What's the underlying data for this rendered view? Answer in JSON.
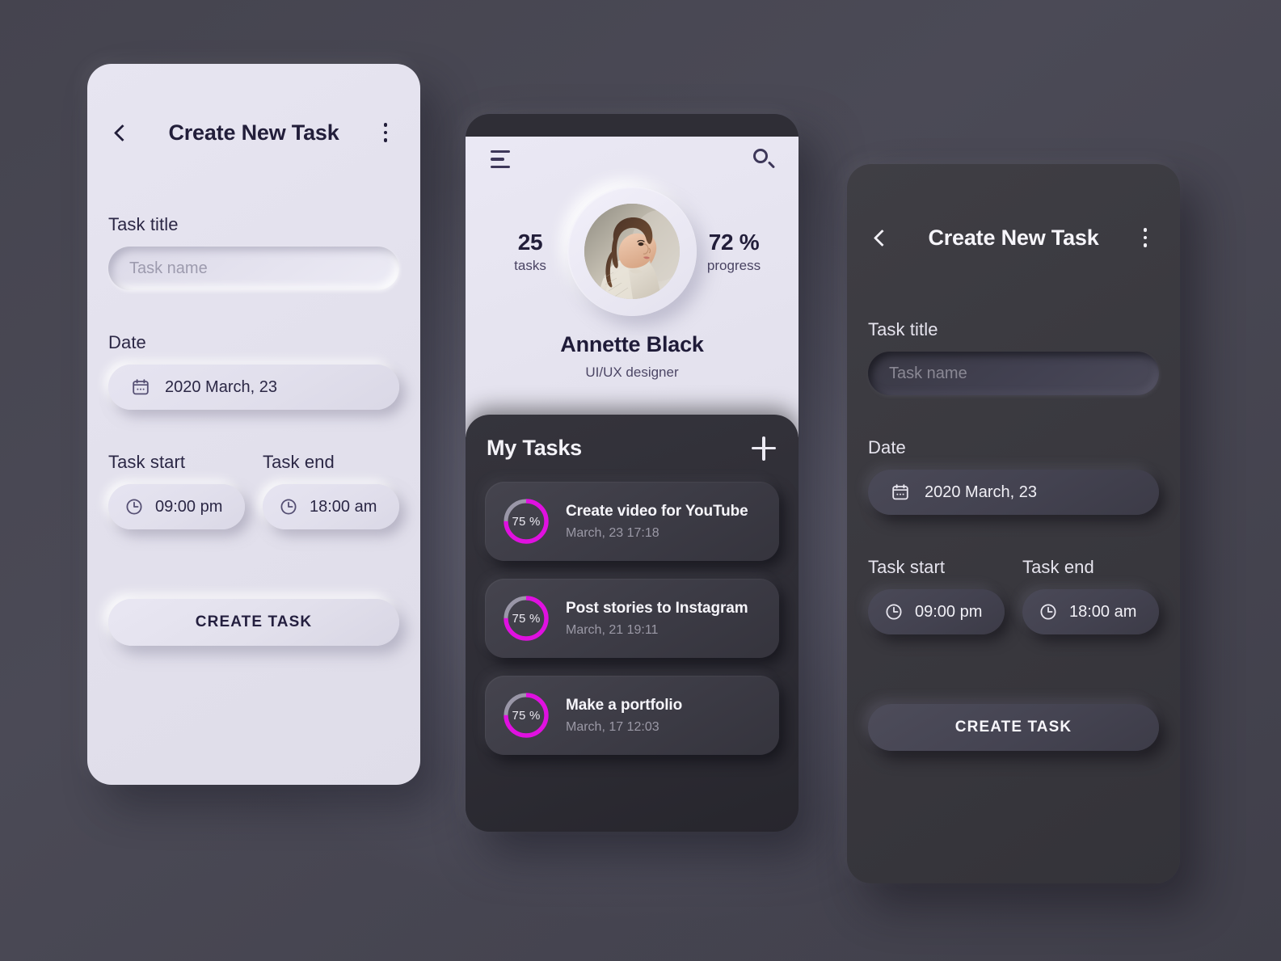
{
  "theme": {
    "accent_magenta": "#e010e0",
    "light_surface": "#e3e1ed",
    "dark_surface": "#3a393f",
    "page_background": "#44434e",
    "ring_track": "#9a97a8"
  },
  "screen_light": {
    "appbar": {
      "back_icon": "chevron-left-icon",
      "title": "Create New Task",
      "menu_icon": "kebab-menu-icon"
    },
    "labels": {
      "task_title": "Task title",
      "date": "Date",
      "task_start": "Task start",
      "task_end": "Task end"
    },
    "task_name_input": {
      "value": "",
      "placeholder": "Task name"
    },
    "date_value": "2020 March, 23",
    "date_icon": "calendar-icon",
    "start_value": "09:00 pm",
    "start_icon": "clock-icon",
    "end_value": "18:00 am",
    "end_icon": "clock-icon",
    "submit_label": "CREATE TASK"
  },
  "screen_profile": {
    "appbar": {
      "menu_icon": "hamburger-menu-icon",
      "search_icon": "search-icon"
    },
    "stats": {
      "tasks_count": "25",
      "tasks_label": "tasks",
      "progress_value": "72 %",
      "progress_label": "progress"
    },
    "avatar_alt": "avatar",
    "name": "Annette Black",
    "role": "UI/UX designer",
    "tasks_section": {
      "title": "My Tasks",
      "add_icon": "plus-icon",
      "items": [
        {
          "percent": "75 %",
          "percent_value": 75,
          "name": "Create video for YouTube",
          "date": "March, 23 17:18"
        },
        {
          "percent": "75 %",
          "percent_value": 75,
          "name": "Post stories to Instagram",
          "date": "March, 21 19:11"
        },
        {
          "percent": "75 %",
          "percent_value": 75,
          "name": "Make a portfolio",
          "date": "March, 17 12:03"
        }
      ]
    }
  },
  "screen_dark": {
    "appbar": {
      "back_icon": "chevron-left-icon",
      "title": "Create New Task",
      "menu_icon": "kebab-menu-icon"
    },
    "labels": {
      "task_title": "Task title",
      "date": "Date",
      "task_start": "Task start",
      "task_end": "Task end"
    },
    "task_name_input": {
      "value": "",
      "placeholder": "Task name"
    },
    "date_value": "2020 March, 23",
    "date_icon": "calendar-icon",
    "start_value": "09:00 pm",
    "start_icon": "clock-icon",
    "end_value": "18:00 am",
    "end_icon": "clock-icon",
    "submit_label": "CREATE TASK"
  }
}
